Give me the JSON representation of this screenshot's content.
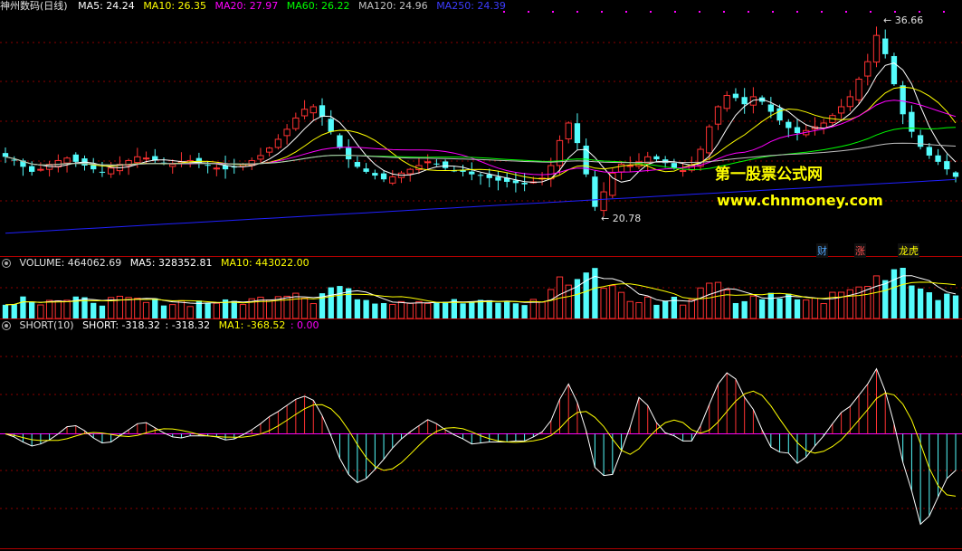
{
  "header_main": {
    "stock": "神州数码(日线)",
    "ma5": "MA5: 24.24",
    "ma10": "MA10: 26.35",
    "ma20": "MA20: 27.97",
    "ma60": "MA60: 26.22",
    "ma120": "MA120: 24.96",
    "ma250": "MA250: 24.39"
  },
  "header_volume": {
    "volume": "VOLUME: 464062.69",
    "ma5": "MA5: 328352.81",
    "ma10": "MA10: 443022.00"
  },
  "header_short": {
    "name": "SHORT(10)",
    "short": "SHORT: -318.32",
    "dup": ": -318.32",
    "ma1": "MA1: -368.52",
    "zero": ": 0.00"
  },
  "annotations": {
    "high": "36.66",
    "low": "20.78"
  },
  "watermark": {
    "line1": "第一股票公式网",
    "line2": "www.chnmoney.com"
  },
  "tags": [
    "财",
    "涨",
    "龙虎"
  ],
  "colors": {
    "up": "#ff3232",
    "down": "#54fcfc",
    "ma5": "#ffffff",
    "ma10": "#ffff00",
    "ma20": "#ff00ff",
    "ma60": "#00ff00",
    "ma120": "#c0c0c0",
    "ma250": "#2020ff",
    "grid": "#8b0000",
    "border": "#b00000"
  },
  "chart_data": {
    "type": "candlestick",
    "price_range_approx": [
      19.5,
      37.5
    ],
    "highest_label": 36.66,
    "lowest_label": 20.78,
    "ma_latest": {
      "MA5": 24.24,
      "MA10": 26.35,
      "MA20": 27.97,
      "MA60": 26.22,
      "MA120": 24.96,
      "MA250": 24.39
    },
    "volume_latest": {
      "VOLUME": 464062.69,
      "MA5": 328352.81,
      "MA10": 443022.0
    },
    "short_latest": {
      "SHORT": -318.32,
      "MA1": -368.52
    },
    "close_path": [
      26.2,
      25.9,
      25.4,
      25.0,
      25.2,
      25.6,
      25.9,
      26.1,
      25.8,
      25.5,
      25.2,
      25.0,
      25.3,
      25.6,
      25.9,
      26.2,
      26.1,
      25.9,
      25.7,
      25.6,
      25.8,
      25.9,
      25.7,
      25.5,
      25.3,
      25.2,
      25.4,
      25.6,
      25.9,
      26.3,
      26.9,
      27.6,
      28.4,
      29.3,
      30.0,
      30.2,
      29.4,
      28.2,
      26.9,
      26.0,
      25.4,
      25.0,
      24.7,
      24.4,
      24.6,
      24.9,
      25.2,
      25.5,
      25.8,
      25.6,
      25.3,
      25.1,
      25.0,
      24.8,
      24.7,
      24.5,
      24.3,
      24.2,
      24.1,
      24.0,
      24.2,
      24.5,
      25.5,
      27.5,
      28.9,
      27.3,
      24.8,
      22.2,
      23.4,
      24.9,
      25.6,
      25.5,
      25.8,
      26.2,
      26.0,
      25.7,
      25.3,
      25.1,
      25.5,
      26.8,
      28.6,
      30.2,
      31.1,
      30.9,
      30.4,
      31.0,
      30.6,
      29.8,
      29.1,
      28.5,
      28.1,
      28.3,
      28.6,
      28.9,
      29.5,
      30.2,
      31.0,
      32.4,
      33.8,
      35.9,
      34.4,
      32.0,
      29.6,
      28.2,
      27.0,
      26.3,
      25.8,
      25.2,
      24.6
    ]
  }
}
